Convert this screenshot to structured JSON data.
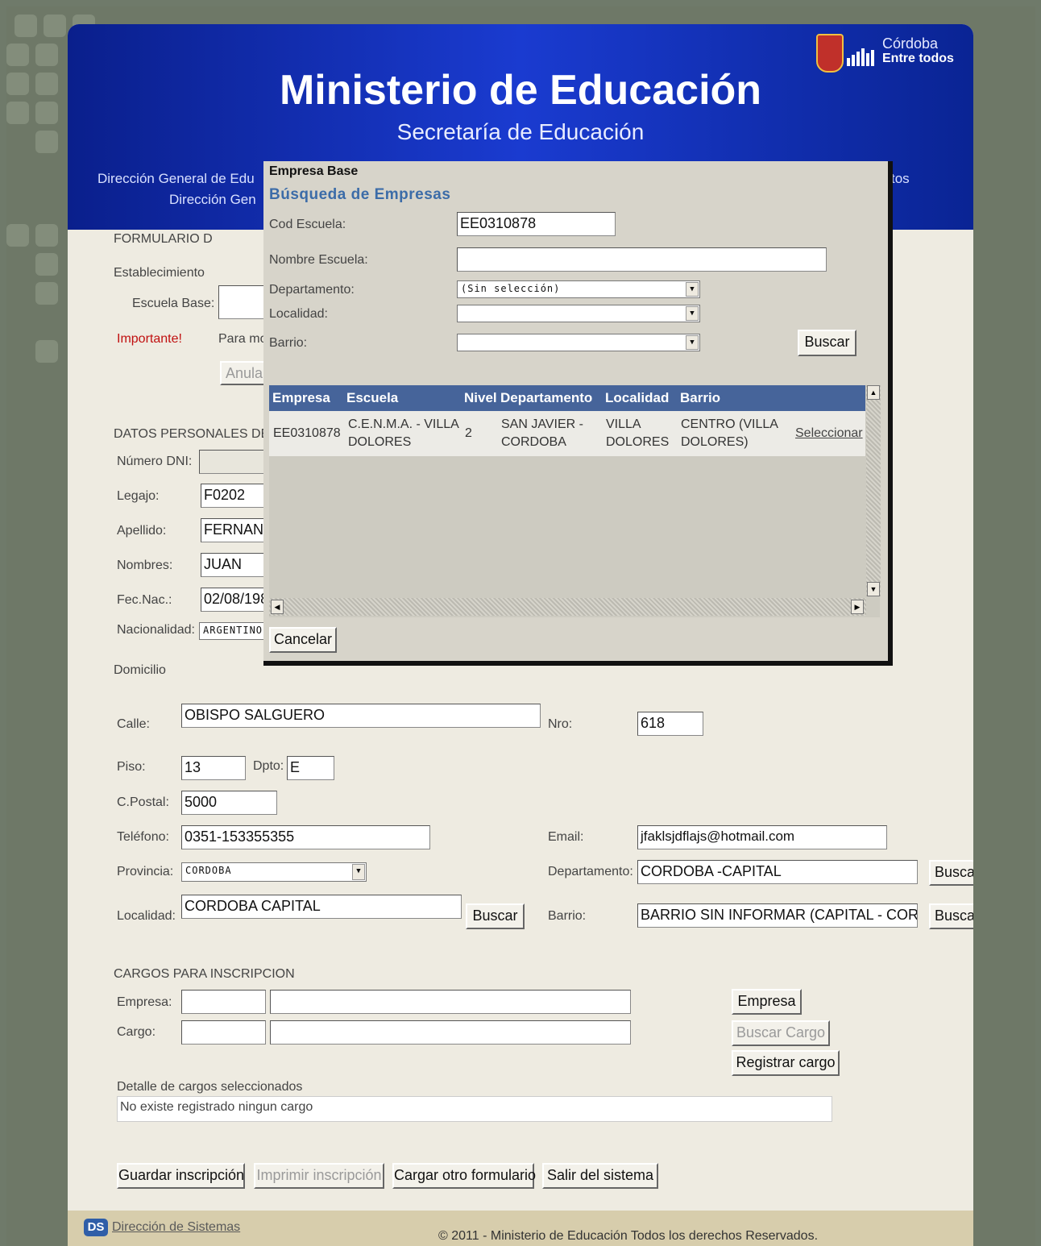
{
  "header": {
    "title": "Ministerio de Educación",
    "subtitle": "Secretaría de Educación",
    "nav_left_1": "Dirección General de Edu",
    "nav_left_2": "Dirección Gen",
    "nav_right": "tos",
    "logo_line1": "Córdoba",
    "logo_line2": "Entre todos"
  },
  "form": {
    "form_title": "FORMULARIO D",
    "establecimiento": "Establecimiento",
    "escuela_base_label": "Escuela Base:",
    "importante": "Importante!",
    "importante_text": "Para mo",
    "anular_button": "Anula",
    "datos_personales": "DATOS PERSONALES DE",
    "dni_label": "Número DNI:",
    "legajo_label": "Legajo:",
    "legajo_value": "F0202",
    "apellido_label": "Apellido:",
    "apellido_value": "FERNAND",
    "nombres_label": "Nombres:",
    "nombres_value": "JUAN",
    "fecnac_label": "Fec.Nac.:",
    "fecnac_value": "02/08/198",
    "nacionalidad_label": "Nacionalidad:",
    "nacionalidad_value": "ARGENTINO",
    "domicilio": "Domicilio",
    "calle_label": "Calle:",
    "calle_value": "OBISPO SALGUERO",
    "nro_label": "Nro:",
    "nro_value": "618",
    "piso_label": "Piso:",
    "piso_value": "13",
    "dpto_label": "Dpto:",
    "dpto_value": "E",
    "cpostal_label": "C.Postal:",
    "cpostal_value": "5000",
    "telefono_label": "Teléfono:",
    "telefono_value": "0351-153355355",
    "email_label": "Email:",
    "email_value": "jfaklsjdflajs@hotmail.com",
    "provincia_label": "Provincia:",
    "provincia_value": "CORDOBA",
    "departamento_label": "Departamento:",
    "departamento_value": "CORDOBA -CAPITAL",
    "localidad_label": "Localidad:",
    "localidad_value": "CORDOBA CAPITAL",
    "barrio_label": "Barrio:",
    "barrio_value": "BARRIO SIN INFORMAR (CAPITAL - CORDOB",
    "buscar": "Buscar",
    "cargos_title": "CARGOS PARA INSCRIPCION",
    "empresa_label": "Empresa:",
    "cargo_label": "Cargo:",
    "empresa_button": "Empresa",
    "buscar_cargo_button": "Buscar Cargo",
    "registrar_cargo_button": "Registrar cargo",
    "detalle_label": "Detalle de cargos seleccionados",
    "detalle_value": "No existe registrado ningun cargo",
    "guardar_button": "Guardar inscripción",
    "imprimir_button": "Imprimir inscripción",
    "cargar_button": "Cargar otro formulario",
    "salir_button": "Salir del sistema"
  },
  "footer": {
    "ds_badge": "DS",
    "sistemas_link": "Dirección de Sistemas",
    "copyright": "© 2011 - Ministerio de Educación Todos los derechos Reservados."
  },
  "modal": {
    "title": "Empresa Base",
    "heading": "Búsqueda de Empresas",
    "cod_label": "Cod Escuela:",
    "cod_value": "EE0310878",
    "nombre_label": "Nombre Escuela:",
    "nombre_value": "",
    "departamento_label": "Departamento:",
    "departamento_value": "(Sin selección)",
    "localidad_label": "Localidad:",
    "localidad_value": "",
    "barrio_label": "Barrio:",
    "barrio_value": "",
    "buscar_button": "Buscar",
    "cancelar_button": "Cancelar",
    "columns": [
      "Empresa",
      "Escuela",
      "Nivel",
      "Departamento",
      "Localidad",
      "Barrio"
    ],
    "row": {
      "empresa": "EE0310878",
      "escuela_1": "C.E.N.M.A. - VILLA",
      "escuela_2": "DOLORES",
      "nivel": "2",
      "departamento_1": "SAN JAVIER -",
      "departamento_2": "CORDOBA",
      "localidad_1": "VILLA",
      "localidad_2": "DOLORES",
      "barrio_1": "CENTRO (VILLA",
      "barrio_2": "DOLORES)",
      "action": "Seleccionar"
    }
  }
}
